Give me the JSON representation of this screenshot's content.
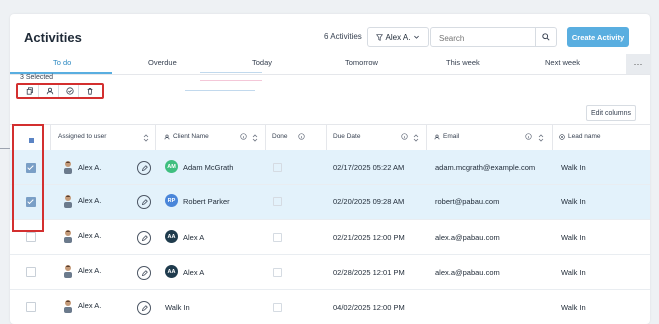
{
  "header": {
    "title": "Activities",
    "activities_count": "6 Activities",
    "owner_filter": "Alex A.",
    "search_placeholder": "Search",
    "create_button": "Create Activity"
  },
  "tabs": [
    {
      "label": "To do",
      "active": true
    },
    {
      "label": "Overdue",
      "active": false
    },
    {
      "label": "Today",
      "active": false
    },
    {
      "label": "Tomorrow",
      "active": false
    },
    {
      "label": "This week",
      "active": false
    },
    {
      "label": "Next week",
      "active": false
    }
  ],
  "tab_more": "⋯",
  "bulk": {
    "selected_label": "3 Selected",
    "actions": [
      "copy-icon",
      "assign-user-icon",
      "complete-icon",
      "delete-icon"
    ]
  },
  "edit_columns": "Edit columns",
  "columns": {
    "assigned": "Assigned to user",
    "client": "Client Name",
    "done": "Done",
    "due": "Due Date",
    "email": "Email",
    "lead": "Lead name"
  },
  "rows": [
    {
      "selected": true,
      "assigned": "Alex A.",
      "client": "Adam McGrath",
      "initials": "AM",
      "avatar_color": "#3fbf7f",
      "due": "02/17/2025 05:22 AM",
      "email": "adam.mcgrath@example.com",
      "lead": "Walk In"
    },
    {
      "selected": true,
      "assigned": "Alex A.",
      "client": "Robert Parker",
      "initials": "RP",
      "avatar_color": "#4a86d9",
      "due": "02/20/2025 09:28 AM",
      "email": "robert@pabau.com",
      "lead": "Walk In"
    },
    {
      "selected": false,
      "assigned": "Alex A.",
      "client": "Alex A",
      "initials": "AA",
      "avatar_color": "#1f3b4d",
      "due": "02/21/2025 12:00 PM",
      "email": "alex.a@pabau.com",
      "lead": "Walk In"
    },
    {
      "selected": false,
      "assigned": "Alex A.",
      "client": "Alex A",
      "initials": "AA",
      "avatar_color": "#1f3b4d",
      "due": "02/28/2025 12:01 PM",
      "email": "alex.a@pabau.com",
      "lead": "Walk In"
    },
    {
      "selected": false,
      "assigned": "Alex A.",
      "client": "Walk In",
      "initials": "",
      "avatar_color": "",
      "due": "04/02/2025 12:00 PM",
      "email": "",
      "lead": "Walk In"
    }
  ],
  "colors": {
    "accent": "#59aee0",
    "selected_row": "#e3f2fb",
    "highlight_box": "#d32f2f"
  }
}
